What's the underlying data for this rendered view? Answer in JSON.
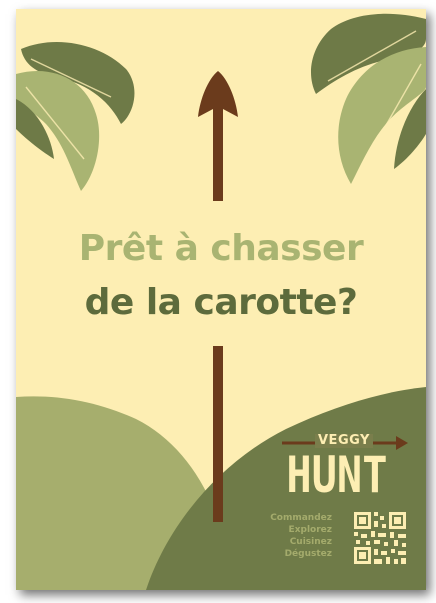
{
  "headline": {
    "line1": "Prêt à chasser",
    "line2": "de la carotte?"
  },
  "logo": {
    "word1": "VEGGY",
    "word2": "HUNT"
  },
  "tagline": [
    "Commandez",
    "Explorez",
    "Cuisinez",
    "Dégustez"
  ],
  "colors": {
    "background": "#fdeeb3",
    "leaf_light": "#a9b472",
    "leaf_dark": "#6e7a47",
    "hill_light": "#a6ae6d",
    "hill_dark": "#6f7b48",
    "arrow": "#6b3b1c",
    "headline_light": "#a9b472",
    "headline_dark": "#5d6b3c"
  },
  "icons": [
    "palm-leaf-icon",
    "arrow-up-icon",
    "arrow-right-icon",
    "qr-code-icon"
  ]
}
